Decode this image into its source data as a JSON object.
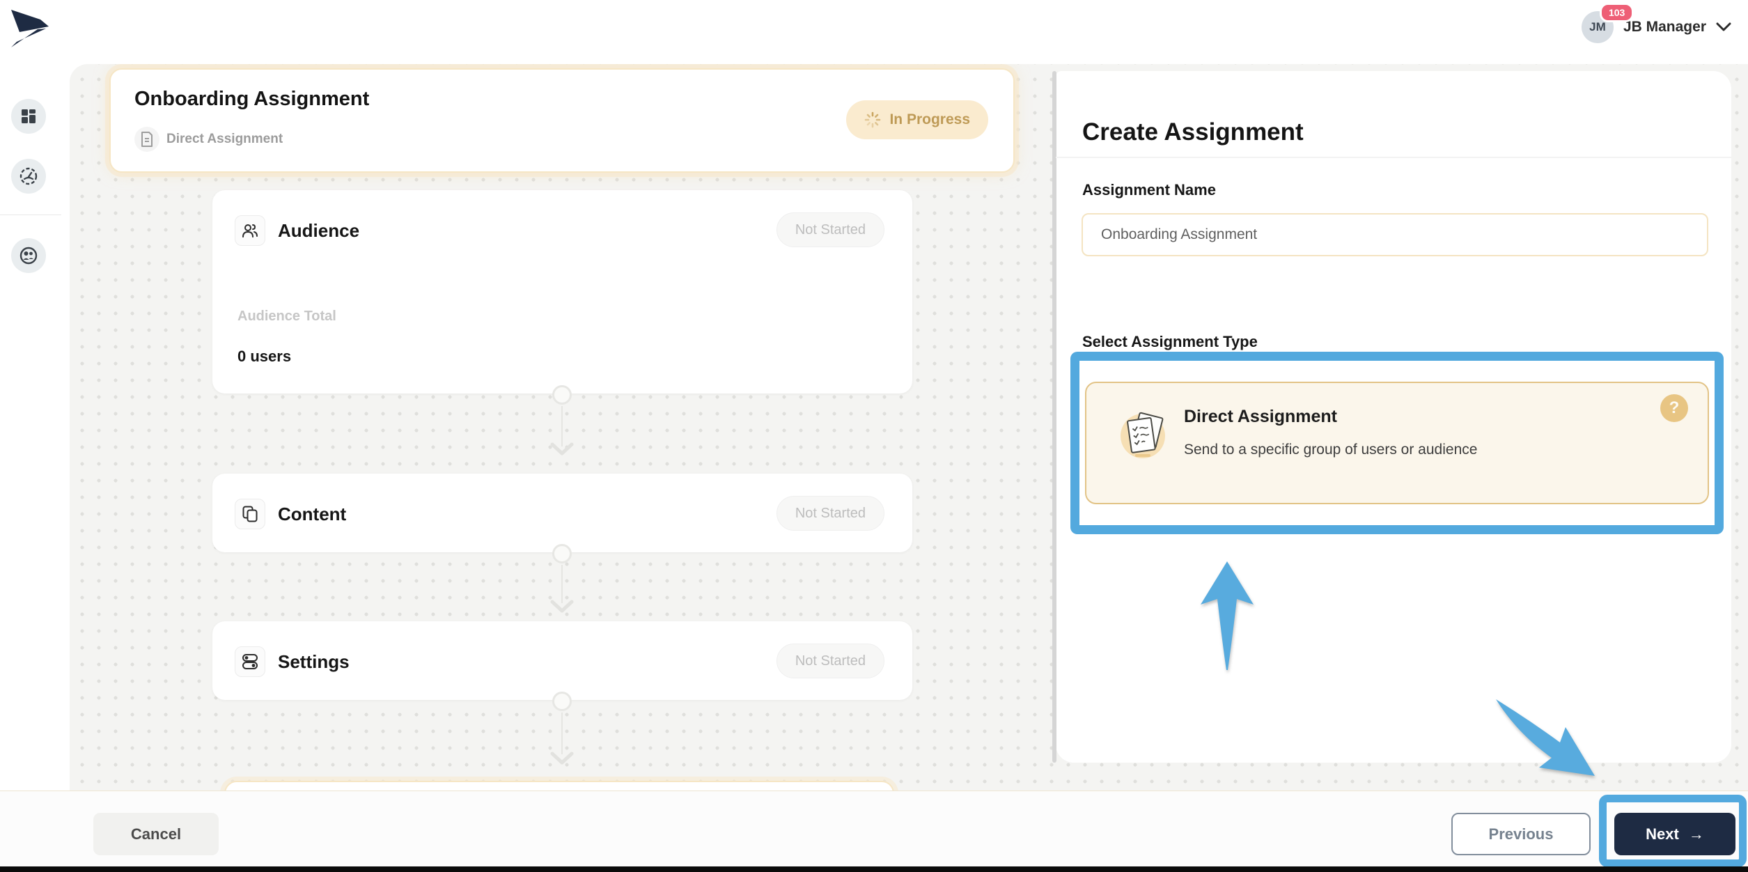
{
  "header": {
    "user": {
      "initials": "JM",
      "name": "JB Manager",
      "badge_count": "103"
    }
  },
  "sidebar": {
    "items": [
      {
        "icon": "dashboard-icon"
      },
      {
        "icon": "gauge-icon"
      },
      {
        "icon": "people-icon"
      }
    ]
  },
  "assignment_header": {
    "title": "Onboarding Assignment",
    "subtitle": "Direct Assignment",
    "status": "In Progress"
  },
  "steps": [
    {
      "title": "Audience",
      "status": "Not Started",
      "total_label": "Audience Total",
      "total_value": "0 users"
    },
    {
      "title": "Content",
      "status": "Not Started"
    },
    {
      "title": "Settings",
      "status": "Not Started"
    }
  ],
  "panel": {
    "title": "Create Assignment",
    "name_label": "Assignment Name",
    "name_value": "Onboarding Assignment",
    "type_label": "Select Assignment Type",
    "type_option": {
      "title": "Direct Assignment",
      "description": "Send to a specific group of users or audience",
      "help": "?"
    }
  },
  "footer": {
    "cancel": "Cancel",
    "previous": "Previous",
    "next": "Next",
    "next_arrow": "→"
  },
  "colors": {
    "navy": "#1E2B43",
    "annotation_blue": "#53A9DE",
    "cream_bg": "#FBF6EB",
    "cream_border": "#E2C386",
    "progress_bg": "#FAEBCF",
    "progress_text": "#BE9A56",
    "badge_red": "#EE5F76"
  }
}
